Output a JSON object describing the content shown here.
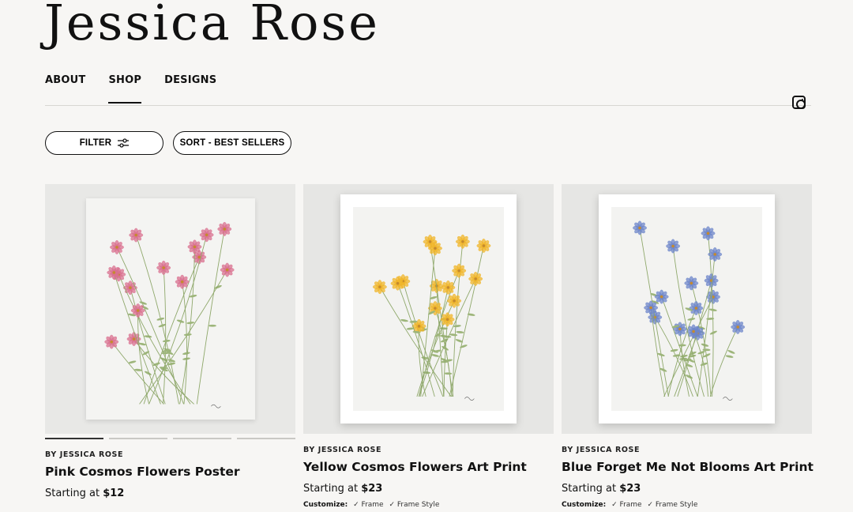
{
  "brand": {
    "name": "Jessica Rose"
  },
  "nav": {
    "items": [
      "ABOUT",
      "SHOP",
      "DESIGNS"
    ],
    "active": "SHOP"
  },
  "social": {
    "icon": "instagram-icon"
  },
  "controls": {
    "filter_label": "FILTER",
    "filter_icon": "sliders-icon",
    "sort_label": "SORT - BEST SELLERS"
  },
  "products": [
    {
      "byline": "BY JESSICA ROSE",
      "title": "Pink Cosmos Flowers Poster",
      "price_prefix": "Starting at",
      "price": "$12",
      "flower_color": "#d9708f",
      "carousel": {
        "count": 4,
        "active": 0
      }
    },
    {
      "byline": "BY JESSICA ROSE",
      "title": "Yellow Cosmos Flowers Art Print",
      "price_prefix": "Starting at",
      "price": "$23",
      "customize_label": "Customize:",
      "options": [
        "✓ Frame",
        "✓ Frame Style"
      ],
      "flower_color": "#f0b62a"
    },
    {
      "byline": "BY JESSICA ROSE",
      "title": "Blue Forget Me Not Blooms Art Print",
      "price_prefix": "Starting at",
      "price": "$23",
      "customize_label": "Customize:",
      "options": [
        "✓ Frame",
        "✓ Frame Style"
      ],
      "flower_color": "#6d86c9"
    }
  ]
}
